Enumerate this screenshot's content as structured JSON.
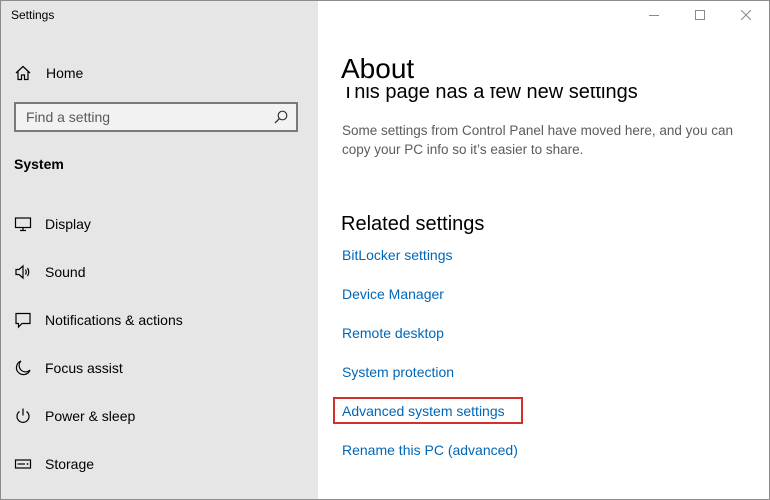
{
  "window": {
    "title": "Settings",
    "controls": [
      {
        "name": "minimize",
        "icon": "minimize-icon"
      },
      {
        "name": "maximize",
        "icon": "maximize-icon"
      },
      {
        "name": "close",
        "icon": "close-icon"
      }
    ]
  },
  "sidebar": {
    "home_label": "Home",
    "home_icon": "home-icon",
    "search": {
      "placeholder": "Find a setting",
      "value": "",
      "icon": "search-icon"
    },
    "section_title": "System",
    "items": [
      {
        "label": "Display",
        "icon": "display-icon"
      },
      {
        "label": "Sound",
        "icon": "speaker-icon"
      },
      {
        "label": "Notifications & actions",
        "icon": "notifications-icon"
      },
      {
        "label": "Focus assist",
        "icon": "moon-icon"
      },
      {
        "label": "Power & sleep",
        "icon": "power-icon"
      },
      {
        "label": "Storage",
        "icon": "storage-icon"
      }
    ]
  },
  "main": {
    "title": "About",
    "notice": {
      "heading": "This page has a few new settings",
      "text": "Some settings from Control Panel have moved here, and you can copy your PC info so it’s easier to share."
    },
    "related": {
      "title": "Related settings",
      "links": [
        {
          "label": "BitLocker settings"
        },
        {
          "label": "Device Manager"
        },
        {
          "label": "Remote desktop"
        },
        {
          "label": "System protection"
        },
        {
          "label": "Advanced system settings",
          "highlighted": true
        },
        {
          "label": "Rename this PC (advanced)"
        }
      ]
    }
  },
  "colors": {
    "sidebar_bg": "#e6e6e6",
    "link": "#0067b8",
    "highlight": "#d32f2f",
    "secondary_text": "#5c5c5c"
  }
}
